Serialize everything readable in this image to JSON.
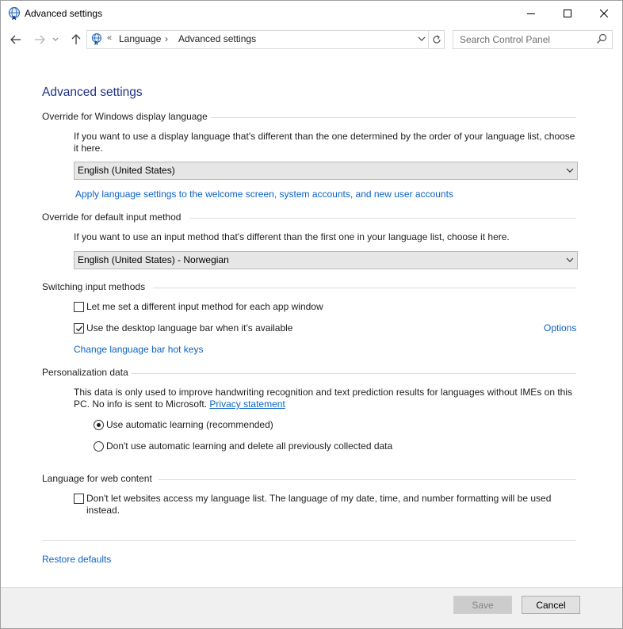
{
  "window": {
    "title": "Advanced settings"
  },
  "address": {
    "chevrons": "«",
    "crumbs": [
      "Language",
      "Advanced settings"
    ],
    "separator": "›"
  },
  "search": {
    "placeholder": "Search Control Panel"
  },
  "page": {
    "title": "Advanced settings"
  },
  "display_language": {
    "title": "Override for Windows display language",
    "desc_line1": "If you want to use a display language that's different than the one determined by the order of your language list, choose",
    "desc_line2": "it here.",
    "selected": "English (United States)",
    "apply_link": "Apply language settings to the welcome screen, system accounts, and new user accounts"
  },
  "input_method": {
    "title": "Override for default input method",
    "desc": "If you want to use an input method that's different than the first one in your language list, choose it here.",
    "selected": "English (United States) - Norwegian"
  },
  "switching": {
    "title": "Switching input methods",
    "per_app_label": "Let me set a different input method for each app window",
    "per_app_checked": false,
    "langbar_label": "Use the desktop language bar when it's available",
    "langbar_checked": true,
    "options_link": "Options",
    "hotkeys_link": "Change language bar hot keys"
  },
  "personalization": {
    "title": "Personalization data",
    "desc_line1": "This data is only used to improve handwriting recognition and text prediction results for languages without IMEs on this",
    "desc_line2": "PC. No info is sent to Microsoft.",
    "privacy_link": "Privacy statement",
    "radio_auto": "Use automatic learning (recommended)",
    "radio_delete": "Don't use automatic learning and delete all previously collected data",
    "selected": "auto"
  },
  "web_content": {
    "title": "Language for web content",
    "label_line1": "Don't let websites access my language list. The language of my date, time, and number formatting will be used",
    "label_line2": "instead.",
    "checked": false
  },
  "restore_link": "Restore defaults",
  "buttons": {
    "save": "Save",
    "cancel": "Cancel"
  },
  "colors": {
    "title_blue": "#1e3287",
    "link_blue": "#0c63c4",
    "footer_bg": "#f0f0f0"
  }
}
